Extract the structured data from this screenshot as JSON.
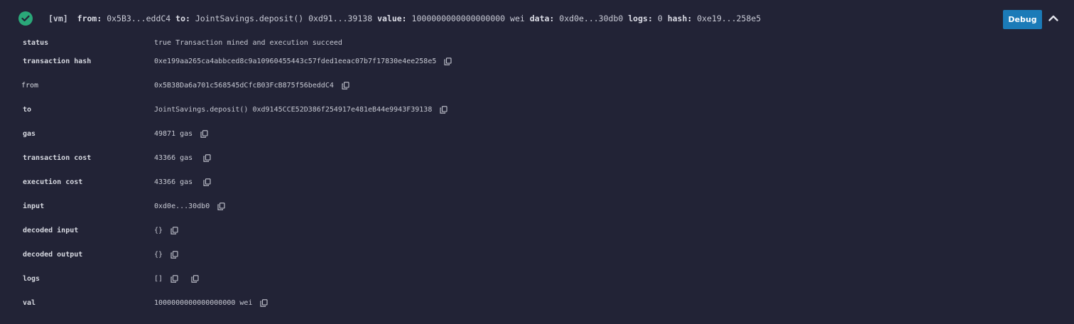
{
  "header": {
    "tag": "[vm]",
    "from_label": "from:",
    "from_value": "0x5B3...eddC4",
    "to_label": "to:",
    "to_value": "JointSavings.deposit() 0xd91...39138",
    "value_label": "value:",
    "value_value": "1000000000000000000 wei",
    "data_label": "data:",
    "data_value": "0xd0e...30db0",
    "logs_label": "logs:",
    "logs_value": "0",
    "hash_label": "hash:",
    "hash_value": "0xe19...258e5",
    "debug_label": "Debug",
    "status_icon": "check-circle-icon",
    "status_color": "#2aa879",
    "accent_color": "#1b7bb8"
  },
  "rows": [
    {
      "label": "status",
      "value": "true Transaction mined and execution succeed",
      "copy": false
    },
    {
      "label": "transaction hash",
      "value": "0xe199aa265ca4abbced8c9a10960455443c57fded1eeac07b7f17830e4ee258e5",
      "copy": true
    },
    {
      "label": "from",
      "value": "0x5B38Da6a701c568545dCfcB03FcB875f56beddC4",
      "copy": true
    },
    {
      "label": "to",
      "value": "JointSavings.deposit() 0xd9145CCE52D386f254917e481eB44e9943F39138",
      "copy": true
    },
    {
      "label": "gas",
      "value": "49871 gas",
      "copy": true
    },
    {
      "label": "transaction cost",
      "value": "43366 gas",
      "copy": true
    },
    {
      "label": "execution cost",
      "value": "43366 gas",
      "copy": true
    },
    {
      "label": "input",
      "value": "0xd0e...30db0",
      "copy": true
    },
    {
      "label": "decoded input",
      "value": "{}",
      "copy": true
    },
    {
      "label": "decoded output",
      "value": "{}",
      "copy": true
    },
    {
      "label": "logs",
      "value": "[]",
      "copy": true,
      "copy2": true
    },
    {
      "label": "val",
      "value": "1000000000000000000 wei",
      "copy": true
    }
  ]
}
